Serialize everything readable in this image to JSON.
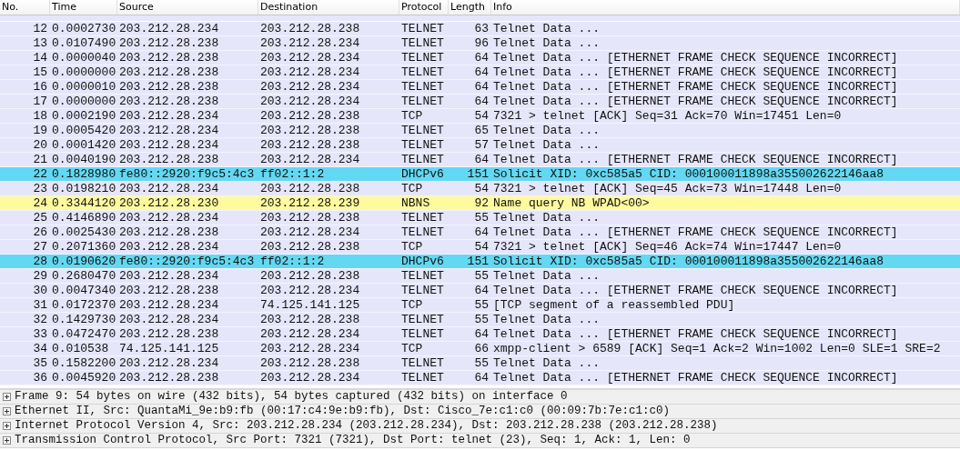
{
  "packet_list": {
    "columns": [
      "No.",
      "Time",
      "Source",
      "Destination",
      "Protocol",
      "Length",
      "Info"
    ],
    "rows": [
      {
        "no": "12",
        "time": "0.0002730",
        "source": "203.212.28.234",
        "destination": "203.212.28.238",
        "protocol": "TELNET",
        "length": "63",
        "info": "Telnet Data ...",
        "color": "#e6e6fa"
      },
      {
        "no": "13",
        "time": "0.0107490",
        "source": "203.212.28.238",
        "destination": "203.212.28.234",
        "protocol": "TELNET",
        "length": "96",
        "info": "Telnet Data ...",
        "color": "#e6e6fa"
      },
      {
        "no": "14",
        "time": "0.0000040",
        "source": "203.212.28.238",
        "destination": "203.212.28.234",
        "protocol": "TELNET",
        "length": "64",
        "info": "Telnet Data ... [ETHERNET FRAME CHECK SEQUENCE INCORRECT]",
        "color": "#e6e6fa"
      },
      {
        "no": "15",
        "time": "0.0000000",
        "source": "203.212.28.238",
        "destination": "203.212.28.234",
        "protocol": "TELNET",
        "length": "64",
        "info": "Telnet Data ... [ETHERNET FRAME CHECK SEQUENCE INCORRECT]",
        "color": "#e6e6fa"
      },
      {
        "no": "16",
        "time": "0.0000010",
        "source": "203.212.28.238",
        "destination": "203.212.28.234",
        "protocol": "TELNET",
        "length": "64",
        "info": "Telnet Data ... [ETHERNET FRAME CHECK SEQUENCE INCORRECT]",
        "color": "#e6e6fa"
      },
      {
        "no": "17",
        "time": "0.0000000",
        "source": "203.212.28.238",
        "destination": "203.212.28.234",
        "protocol": "TELNET",
        "length": "64",
        "info": "Telnet Data ... [ETHERNET FRAME CHECK SEQUENCE INCORRECT]",
        "color": "#e6e6fa"
      },
      {
        "no": "18",
        "time": "0.0002190",
        "source": "203.212.28.234",
        "destination": "203.212.28.238",
        "protocol": "TCP",
        "length": "54",
        "info": "7321 > telnet [ACK] Seq=31 Ack=70 Win=17451 Len=0",
        "color": "#e6e6fa"
      },
      {
        "no": "19",
        "time": "0.0005420",
        "source": "203.212.28.234",
        "destination": "203.212.28.238",
        "protocol": "TELNET",
        "length": "65",
        "info": "Telnet Data ...",
        "color": "#e6e6fa"
      },
      {
        "no": "20",
        "time": "0.0001420",
        "source": "203.212.28.234",
        "destination": "203.212.28.238",
        "protocol": "TELNET",
        "length": "57",
        "info": "Telnet Data ...",
        "color": "#e6e6fa"
      },
      {
        "no": "21",
        "time": "0.0040190",
        "source": "203.212.28.238",
        "destination": "203.212.28.234",
        "protocol": "TELNET",
        "length": "64",
        "info": "Telnet Data ... [ETHERNET FRAME CHECK SEQUENCE INCORRECT]",
        "color": "#e6e6fa"
      },
      {
        "no": "22",
        "time": "0.1828980",
        "source": "fe80::2920:f9c5:4c3",
        "destination": "ff02::1:2",
        "protocol": "DHCPv6",
        "length": "151",
        "info": "Solicit XID: 0xc585a5 CID: 000100011898a355002622146aa8",
        "color": "#63d8f2"
      },
      {
        "no": "23",
        "time": "0.0198210",
        "source": "203.212.28.234",
        "destination": "203.212.28.238",
        "protocol": "TCP",
        "length": "54",
        "info": "7321 > telnet [ACK] Seq=45 Ack=73 Win=17448 Len=0",
        "color": "#e6e6fa"
      },
      {
        "no": "24",
        "time": "0.3344120",
        "source": "203.212.28.230",
        "destination": "203.212.28.239",
        "protocol": "NBNS",
        "length": "92",
        "info": "Name query NB WPAD<00>",
        "color": "#fffa9e"
      },
      {
        "no": "25",
        "time": "0.4146890",
        "source": "203.212.28.234",
        "destination": "203.212.28.238",
        "protocol": "TELNET",
        "length": "55",
        "info": "Telnet Data ...",
        "color": "#e6e6fa"
      },
      {
        "no": "26",
        "time": "0.0025430",
        "source": "203.212.28.238",
        "destination": "203.212.28.234",
        "protocol": "TELNET",
        "length": "64",
        "info": "Telnet Data ... [ETHERNET FRAME CHECK SEQUENCE INCORRECT]",
        "color": "#e6e6fa"
      },
      {
        "no": "27",
        "time": "0.2071360",
        "source": "203.212.28.234",
        "destination": "203.212.28.238",
        "protocol": "TCP",
        "length": "54",
        "info": "7321 > telnet [ACK] Seq=46 Ack=74 Win=17447 Len=0",
        "color": "#e6e6fa"
      },
      {
        "no": "28",
        "time": "0.0190620",
        "source": "fe80::2920:f9c5:4c3",
        "destination": "ff02::1:2",
        "protocol": "DHCPv6",
        "length": "151",
        "info": "Solicit XID: 0xc585a5 CID: 000100011898a355002622146aa8",
        "color": "#63d8f2"
      },
      {
        "no": "29",
        "time": "0.2680470",
        "source": "203.212.28.234",
        "destination": "203.212.28.238",
        "protocol": "TELNET",
        "length": "55",
        "info": "Telnet Data ...",
        "color": "#e6e6fa"
      },
      {
        "no": "30",
        "time": "0.0047340",
        "source": "203.212.28.238",
        "destination": "203.212.28.234",
        "protocol": "TELNET",
        "length": "64",
        "info": "Telnet Data ... [ETHERNET FRAME CHECK SEQUENCE INCORRECT]",
        "color": "#e6e6fa"
      },
      {
        "no": "31",
        "time": "0.0172370",
        "source": "203.212.28.234",
        "destination": "74.125.141.125",
        "protocol": "TCP",
        "length": "55",
        "info": "[TCP segment of a reassembled PDU]",
        "color": "#e6e6fa"
      },
      {
        "no": "32",
        "time": "0.1429730",
        "source": "203.212.28.234",
        "destination": "203.212.28.238",
        "protocol": "TELNET",
        "length": "55",
        "info": "Telnet Data ...",
        "color": "#e6e6fa"
      },
      {
        "no": "33",
        "time": "0.0472470",
        "source": "203.212.28.238",
        "destination": "203.212.28.234",
        "protocol": "TELNET",
        "length": "64",
        "info": "Telnet Data ... [ETHERNET FRAME CHECK SEQUENCE INCORRECT]",
        "color": "#e6e6fa"
      },
      {
        "no": "34",
        "time": "0.010538",
        "source": "74.125.141.125",
        "destination": "203.212.28.234",
        "protocol": "TCP",
        "length": "66",
        "info": "xmpp-client > 6589 [ACK] Seq=1 Ack=2 Win=1002 Len=0 SLE=1 SRE=2",
        "color": "#e6e6fa"
      },
      {
        "no": "35",
        "time": "0.1582200",
        "source": "203.212.28.234",
        "destination": "203.212.28.238",
        "protocol": "TELNET",
        "length": "55",
        "info": "Telnet Data ...",
        "color": "#e6e6fa"
      },
      {
        "no": "36",
        "time": "0.0045920",
        "source": "203.212.28.238",
        "destination": "203.212.28.234",
        "protocol": "TELNET",
        "length": "64",
        "info": "Telnet Data ... [ETHERNET FRAME CHECK SEQUENCE INCORRECT]",
        "color": "#e6e6fa"
      }
    ]
  },
  "packet_details": [
    {
      "text": "Frame 9: 54 bytes on wire (432 bits), 54 bytes captured (432 bits) on interface 0",
      "expanded": false
    },
    {
      "text": "Ethernet II, Src: QuantaMi_9e:b9:fb (00:17:c4:9e:b9:fb), Dst: Cisco_7e:c1:c0 (00:09:7b:7e:c1:c0)",
      "expanded": false
    },
    {
      "text": "Internet Protocol Version 4, Src: 203.212.28.234 (203.212.28.234), Dst: 203.212.28.238 (203.212.28.238)",
      "expanded": false
    },
    {
      "text": "Transmission Control Protocol, Src Port: 7321 (7321), Dst Port: telnet (23), Seq: 1, Ack: 1, Len: 0",
      "expanded": false
    }
  ]
}
